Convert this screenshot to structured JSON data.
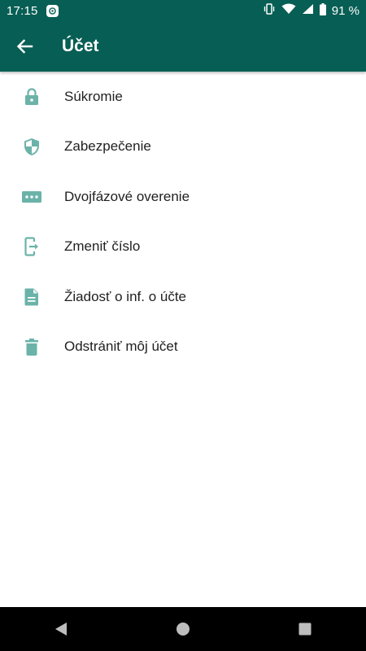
{
  "status_bar": {
    "time": "17:15",
    "battery_text": "91 %",
    "bg_color": "#075e54"
  },
  "app_bar": {
    "title": "Účet",
    "back_icon": "arrow-back-icon",
    "bg_color": "#075e54"
  },
  "accent_color": "#6bb3a8",
  "menu": {
    "items": [
      {
        "label": "Súkromie",
        "icon": "lock-icon"
      },
      {
        "label": "Zabezpečenie",
        "icon": "shield-icon"
      },
      {
        "label": "Dvojfázové overenie",
        "icon": "password-dots-icon"
      },
      {
        "label": "Zmeniť číslo",
        "icon": "change-number-icon"
      },
      {
        "label": "Žiadosť o inf. o účte",
        "icon": "document-icon"
      },
      {
        "label": "Odstrániť môj účet",
        "icon": "trash-icon"
      }
    ]
  },
  "nav_bar": {
    "buttons": [
      "back-triangle-icon",
      "home-circle-icon",
      "recents-square-icon"
    ]
  }
}
